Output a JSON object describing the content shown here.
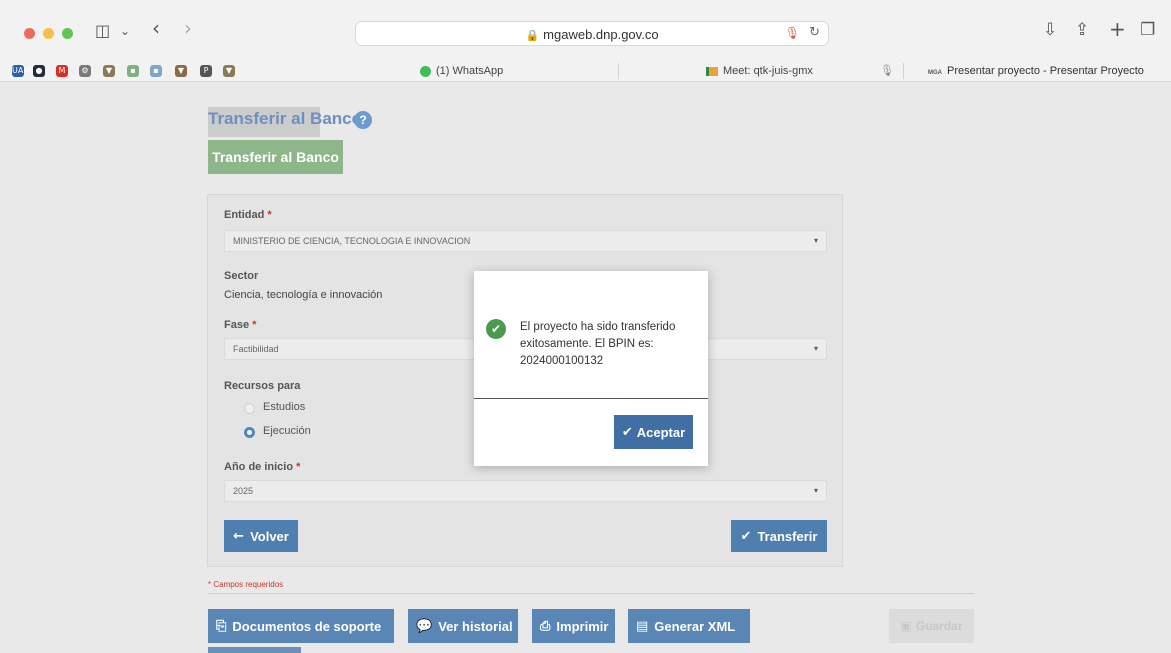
{
  "browser": {
    "url": "mgaweb.dnp.gov.co",
    "lock_icon": "🔒",
    "mic_icon": "🎙",
    "reload_icon": "↻",
    "back_icon": "‹",
    "forward_icon": "›",
    "sidebar_icon": "◫",
    "chevron_icon": "⌄",
    "download_icon": "⇩",
    "share_icon": "⇪",
    "newtab_icon": "+",
    "tabs_icon": "❐",
    "favorites": [
      {
        "label": "UAM",
        "color": "#2d5fa8"
      },
      {
        "label": "●",
        "color": "#1f2d3d"
      },
      {
        "label": "M",
        "color": "#d93025"
      },
      {
        "label": "⚙",
        "color": "#7a7a7a"
      },
      {
        "label": "▼",
        "color": "#8a7a5a"
      },
      {
        "label": "▪",
        "color": "#7fb07f"
      },
      {
        "label": "▪",
        "color": "#7fa7c7"
      },
      {
        "label": "▼",
        "color": "#8a6a4a"
      },
      {
        "label": "P",
        "color": "#555555"
      },
      {
        "label": "▼",
        "color": "#8a7a5a"
      }
    ],
    "tab_whatsapp": "(1) WhatsApp",
    "tab_meet": "Meet: qtk-juis-gmx",
    "tab_current": "Presentar proyecto - Presentar Proyecto",
    "tab_current_prefix": "MGA"
  },
  "page": {
    "title": "Transferir al Banco",
    "help_icon": "?",
    "green_button": "Transferir al Banco"
  },
  "form": {
    "entidad_label": "Entidad",
    "entidad_value": "MINISTERIO DE CIENCIA, TECNOLOGIA E INNOVACION",
    "sector_label": "Sector",
    "sector_value": "Ciencia, tecnología e innovación",
    "fase_label": "Fase",
    "fase_value": "Factibilidad",
    "recursos_label": "Recursos para",
    "option_estudios": "Estudios",
    "option_ejecucion": "Ejecución",
    "anio_label": "Año de inicio",
    "anio_value": "2025",
    "required_mark": "*",
    "caret": "▾",
    "volver_label": "Volver",
    "volver_icon": "←",
    "transferir_label": "Transferir",
    "transferir_icon": "✔"
  },
  "required_note": "* Campos requeridos",
  "bottom": {
    "documentos": "Documentos de soporte",
    "documentos_icon": "⎘",
    "historial": "Ver historial",
    "historial_icon": "💬",
    "imprimir": "Imprimir",
    "imprimir_icon": "⎙",
    "xml": "Generar XML",
    "xml_icon": "▤",
    "guardar": "Guardar",
    "guardar_icon": "▣"
  },
  "modal": {
    "message": "El proyecto ha sido transferido exitosamente. El BPIN es: 2024000100132",
    "check_icon": "✔",
    "ok_label": "Aceptar",
    "ok_icon": "✔"
  }
}
